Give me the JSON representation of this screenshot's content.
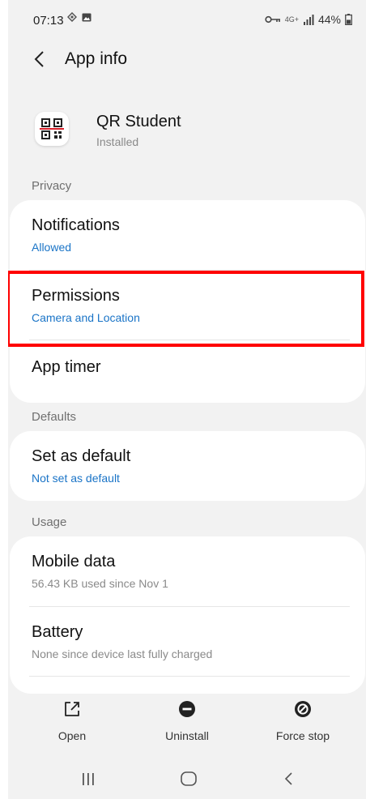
{
  "status_bar": {
    "time": "07:13",
    "left_icons": [
      "gps-icon",
      "image-icon"
    ],
    "right_icons": [
      "key-icon",
      "wifi-4g-icon",
      "signal-icon"
    ],
    "network_label": "4G+",
    "battery": "44%"
  },
  "header": {
    "title": "App info"
  },
  "app": {
    "name": "QR Student",
    "status": "Installed"
  },
  "sections": {
    "privacy": "Privacy",
    "defaults": "Defaults",
    "usage": "Usage"
  },
  "privacy_items": [
    {
      "title": "Notifications",
      "subtitle": "Allowed"
    },
    {
      "title": "Permissions",
      "subtitle": "Camera and Location"
    },
    {
      "title": "App timer"
    }
  ],
  "defaults_items": [
    {
      "title": "Set as default",
      "subtitle": "Not set as default"
    }
  ],
  "usage_items": [
    {
      "title": "Mobile data",
      "subtitle": "56.43 KB used since Nov 1"
    },
    {
      "title": "Battery",
      "subtitle": "None since device last fully charged"
    }
  ],
  "actions": {
    "open": "Open",
    "uninstall": "Uninstall",
    "force_stop": "Force stop"
  },
  "colors": {
    "accent_blue": "#1a74c7",
    "highlight_red": "#ff0000",
    "background": "#f2f2f2"
  }
}
